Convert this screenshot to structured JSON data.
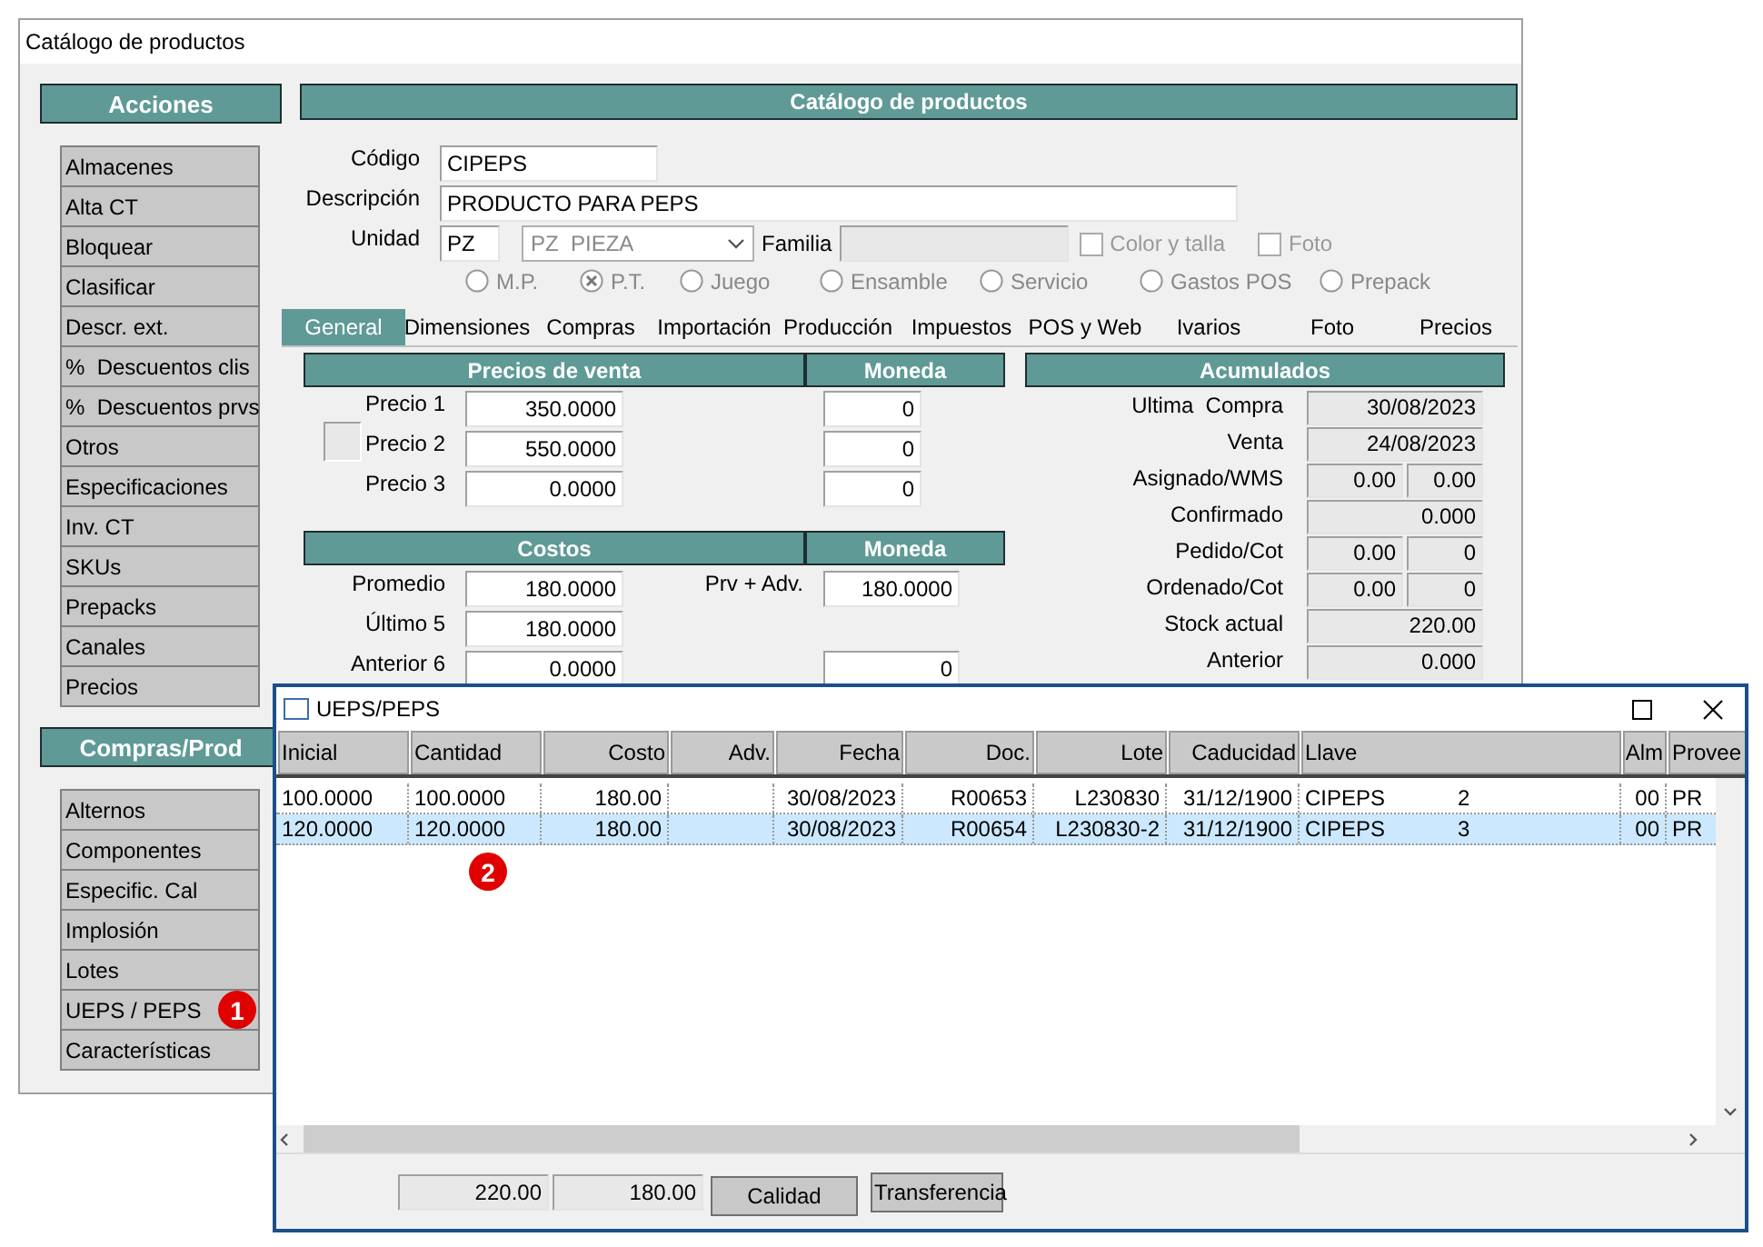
{
  "main_window": {
    "title": "Catálogo de productos"
  },
  "sidebar": {
    "sections": [
      {
        "title": "Acciones",
        "items": [
          {
            "label": "Almacenes"
          },
          {
            "label": "Alta CT"
          },
          {
            "label": "Bloquear"
          },
          {
            "label": "Clasificar"
          },
          {
            "label": "Descr. ext."
          },
          {
            "label": "%  Descuentos clis"
          },
          {
            "label": "%  Descuentos prvs"
          },
          {
            "label": "Otros"
          },
          {
            "label": "Especificaciones"
          },
          {
            "label": "Inv. CT"
          },
          {
            "label": "SKUs"
          },
          {
            "label": "Prepacks"
          },
          {
            "label": "Canales"
          },
          {
            "label": "Precios"
          }
        ]
      },
      {
        "title": "Compras/Prod",
        "items": [
          {
            "label": "Alternos"
          },
          {
            "label": "Componentes"
          },
          {
            "label": "Especific. Cal"
          },
          {
            "label": "Implosión"
          },
          {
            "label": "Lotes"
          },
          {
            "label": "UEPS / PEPS",
            "marker": "1"
          },
          {
            "label": "Características"
          }
        ]
      }
    ]
  },
  "form": {
    "header": "Catálogo de productos",
    "codigo": {
      "label": "Código",
      "value": "CIPEPS"
    },
    "descripcion": {
      "label": "Descripción",
      "value": "PRODUCTO PARA PEPS"
    },
    "unidad": {
      "label": "Unidad",
      "value": "PZ",
      "combo": "PZ  PIEZA",
      "combo_disabled": true
    },
    "familia": {
      "label": "Familia",
      "disabled": true
    },
    "checkboxes": [
      {
        "label": "Color y talla",
        "checked": false,
        "disabled": true
      },
      {
        "label": "Foto",
        "checked": false,
        "disabled": true
      }
    ],
    "radios": [
      {
        "label": "M.P.",
        "selected": false,
        "disabled": true
      },
      {
        "label": "P.T.",
        "selected": true,
        "disabled": true
      },
      {
        "label": "Juego",
        "selected": false,
        "disabled": true
      },
      {
        "label": "Ensamble",
        "selected": false,
        "disabled": true
      },
      {
        "label": "Servicio",
        "selected": false,
        "disabled": true
      },
      {
        "label": "Gastos POS",
        "selected": false,
        "disabled": true
      },
      {
        "label": "Prepack",
        "selected": false,
        "disabled": true
      }
    ]
  },
  "tabs": [
    {
      "label": "General",
      "selected": true
    },
    {
      "label": "Dimensiones",
      "selected": false
    },
    {
      "label": "Compras",
      "selected": false
    },
    {
      "label": "Importación",
      "selected": false
    },
    {
      "label": "Producción",
      "selected": false
    },
    {
      "label": "Impuestos",
      "selected": false
    },
    {
      "label": "POS y Web",
      "selected": false
    },
    {
      "label": "Ivarios",
      "selected": false
    },
    {
      "label": "Foto",
      "selected": false
    },
    {
      "label": "Precios",
      "selected": false
    }
  ],
  "precios": {
    "header": "Precios de venta",
    "moneda_header": "Moneda",
    "rows": [
      {
        "label": "Precio 1",
        "value": "350.0000",
        "moneda": "0"
      },
      {
        "label": "Precio 2",
        "value": "550.0000",
        "moneda": "0"
      },
      {
        "label": "Precio 3",
        "value": "0.0000",
        "moneda": "0"
      }
    ]
  },
  "costos": {
    "header": "Costos",
    "moneda_header": "Moneda",
    "rows": [
      {
        "label": "Promedio",
        "value": "180.0000",
        "side_label": "Prv + Adv.",
        "side_value": "180.0000"
      },
      {
        "label": "Último 5",
        "value": "180.0000"
      },
      {
        "label": "Anterior 6",
        "value": "0.0000",
        "side_value": "0"
      }
    ]
  },
  "acumulados": {
    "header": "Acumulados",
    "rows": [
      {
        "label": "Ultima  Compra",
        "values": [
          "30/08/2023"
        ]
      },
      {
        "label": "Venta",
        "values": [
          "24/08/2023"
        ]
      },
      {
        "label": "Asignado/WMS",
        "values": [
          "0.00",
          "0.00"
        ]
      },
      {
        "label": "Confirmado",
        "values": [
          "0.000"
        ]
      },
      {
        "label": "Pedido/Cot",
        "values": [
          "0.00",
          "0"
        ]
      },
      {
        "label": "Ordenado/Cot",
        "values": [
          "0.00",
          "0"
        ]
      },
      {
        "label": "Stock actual",
        "values": [
          "220.00"
        ]
      },
      {
        "label": "Anterior",
        "values": [
          "0.000"
        ]
      }
    ]
  },
  "dialog": {
    "title": "UEPS/PEPS",
    "columns": [
      "Inicial",
      "Cantidad",
      "Costo",
      "Adv.",
      "Fecha",
      "Doc.",
      "Lote",
      "Caducidad",
      "Llave",
      "Alm",
      "Provee"
    ],
    "rows": [
      {
        "selected": false,
        "cells": [
          "100.0000",
          "100.0000",
          "180.00",
          "",
          "30/08/2023",
          "R00653",
          "L230830",
          "31/12/1900",
          "CIPEPS",
          "00",
          "PR"
        ],
        "llave_seq": "2"
      },
      {
        "selected": true,
        "cells": [
          "120.0000",
          "120.0000",
          "180.00",
          "",
          "30/08/2023",
          "R00654",
          "L230830-2",
          "31/12/1900",
          "CIPEPS",
          "00",
          "PR"
        ],
        "llave_seq": "3"
      }
    ],
    "totals": [
      "220.00",
      "180.00"
    ],
    "buttons": [
      "Calidad",
      "Transferencia"
    ]
  },
  "annotations": [
    "2"
  ]
}
